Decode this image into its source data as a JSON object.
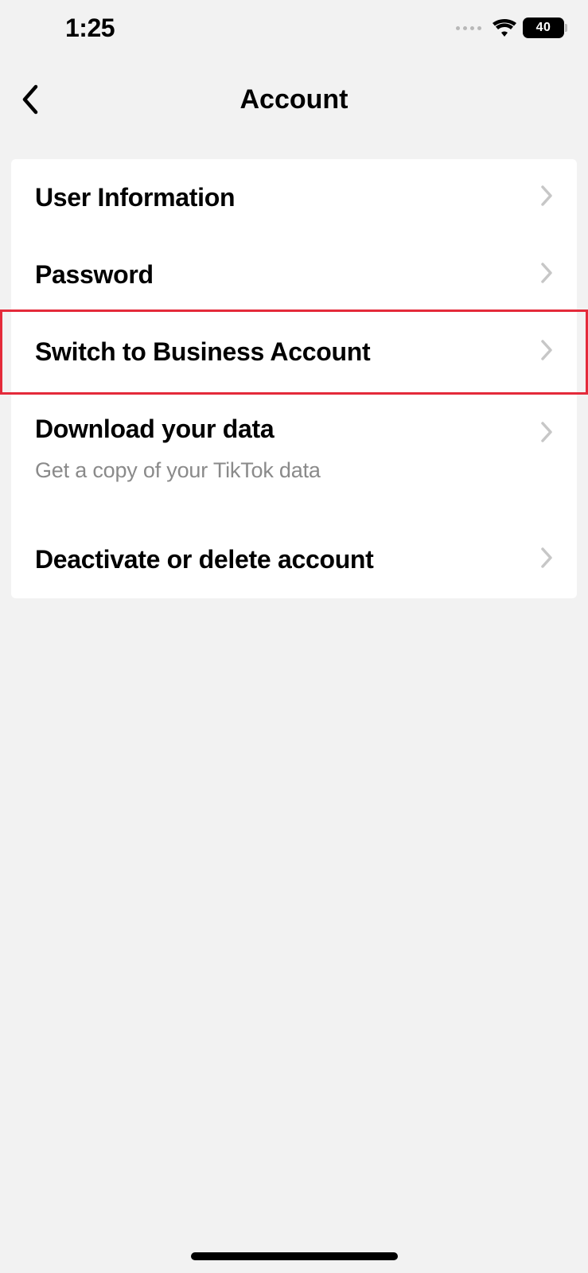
{
  "status": {
    "time": "1:25",
    "battery": "40"
  },
  "header": {
    "title": "Account"
  },
  "items": [
    {
      "label": "User Information",
      "highlighted": false
    },
    {
      "label": "Password",
      "highlighted": false
    },
    {
      "label": "Switch to Business Account",
      "highlighted": true
    },
    {
      "label": "Download your data",
      "subtitle": "Get a copy of your TikTok data",
      "highlighted": false
    },
    {
      "label": "Deactivate or delete account",
      "highlighted": false
    }
  ]
}
